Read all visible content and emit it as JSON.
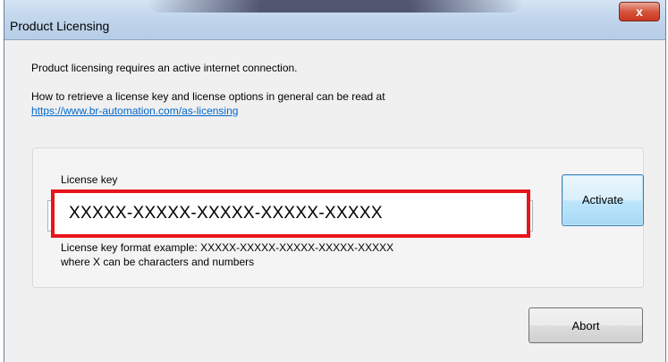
{
  "window": {
    "title": "Product Licensing",
    "close_glyph": "x"
  },
  "info": {
    "line1": "Product licensing requires an active internet connection.",
    "line2": "How to retrieve a license key and license options in general can be read at",
    "link": "https://www.br-automation.com/as-licensing"
  },
  "license": {
    "label": "License key",
    "value": "XXXXX-XXXXX-XXXXX-XXXXX-XXXXX",
    "format_line1": "License  key  format  example:  XXXXX-XXXXX-XXXXX-XXXXX-XXXXX",
    "format_line2": "where X can be characters and numbers"
  },
  "buttons": {
    "activate": "Activate",
    "abort": "Abort"
  },
  "colors": {
    "highlight": "#e8141b",
    "link": "#0066cc"
  }
}
